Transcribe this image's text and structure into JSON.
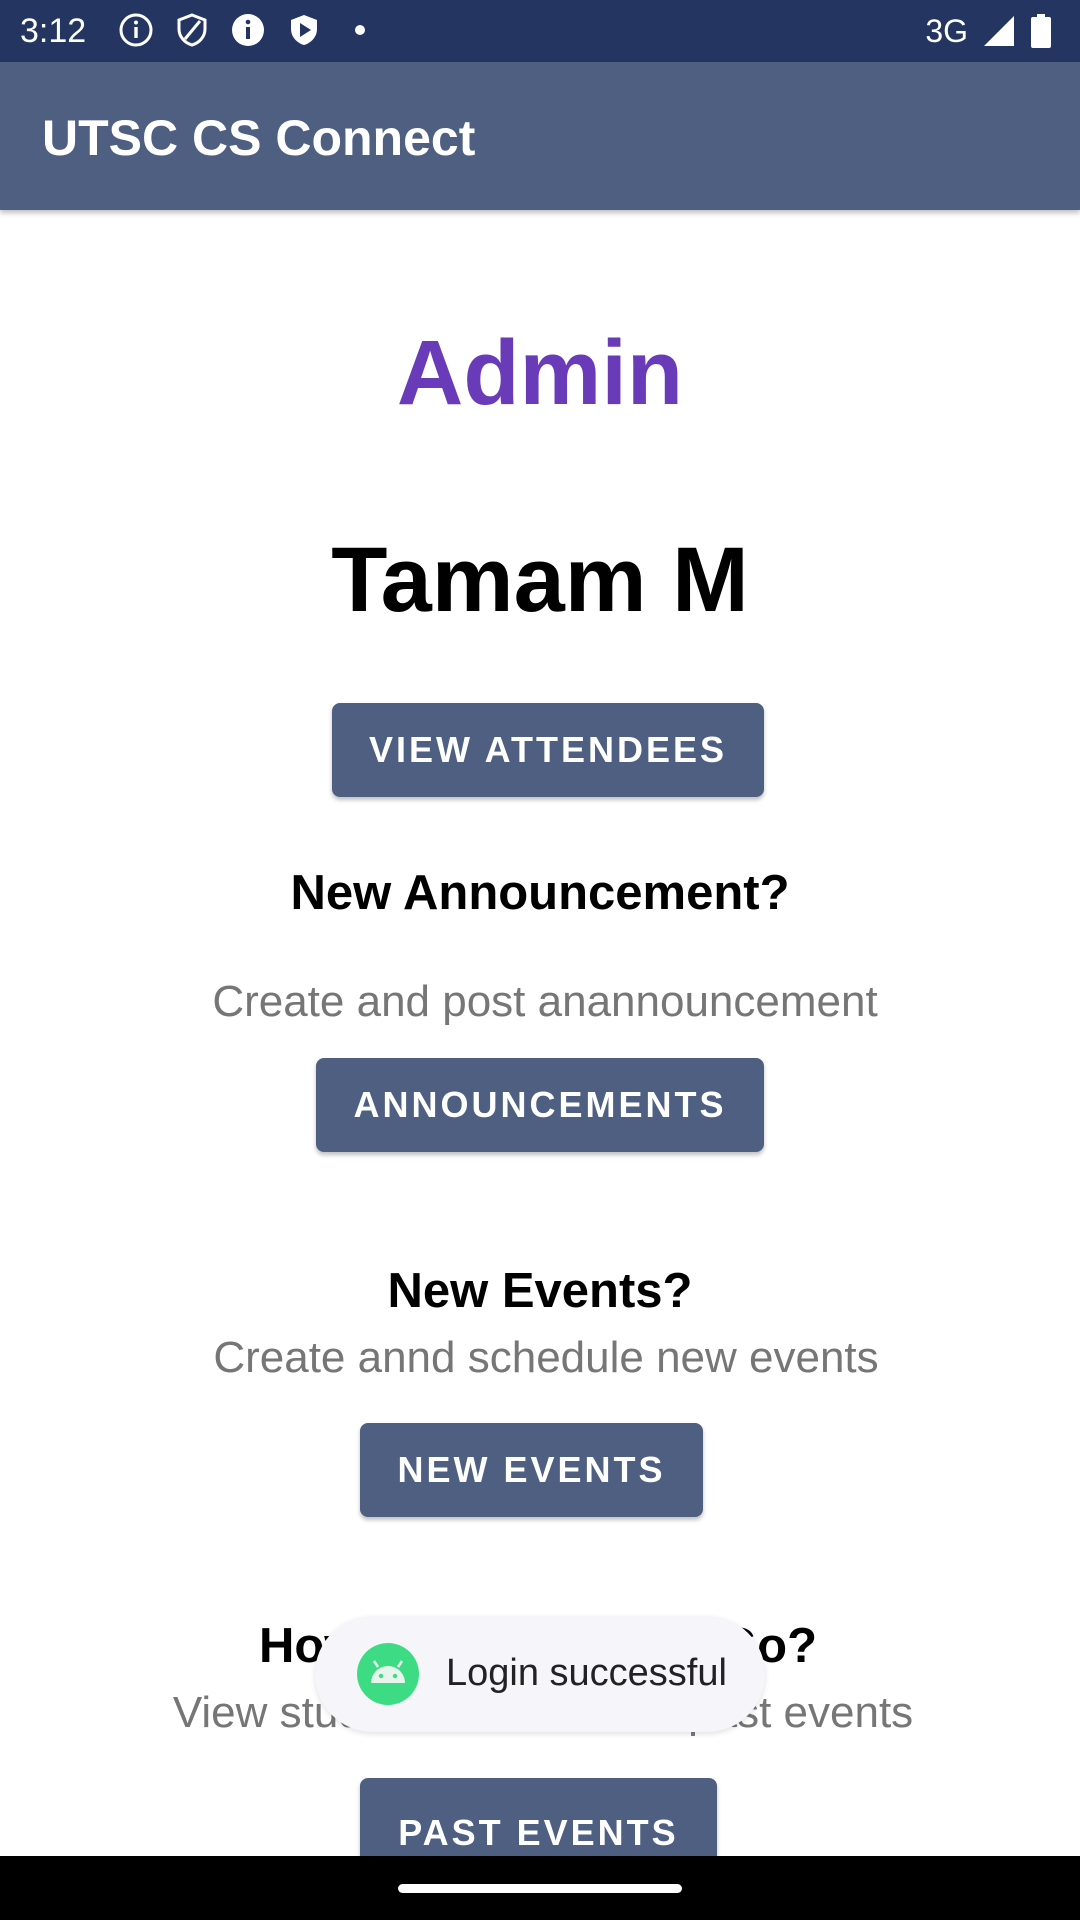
{
  "status_bar": {
    "time": "3:12",
    "network": "3G",
    "icons": [
      "info-icon",
      "shield-icon",
      "info-filled-icon",
      "play-shield-icon",
      "dot-icon",
      "signal-icon",
      "battery-icon"
    ]
  },
  "app_bar": {
    "title": "UTSC CS Connect"
  },
  "main": {
    "role": "Admin",
    "name": "Tamam M",
    "view_attendees_label": "VIEW ATTENDEES",
    "announcement_heading": "New Announcement?",
    "announcement_sub": "Create and post anannouncement",
    "announcements_label": "ANNOUNCEMENTS",
    "events_heading": "New Events?",
    "events_sub": "Create annd schedule new events",
    "new_events_label": "NEW EVENTS",
    "past_heading": "How did the events Go?",
    "past_sub": "View student feedback on past events",
    "past_events_label": "PAST EVENTS"
  },
  "toast": {
    "text": "Login successful",
    "icon": "android-icon"
  },
  "colors": {
    "status_bar": "#233560",
    "app_bar": "#4e5f82",
    "button": "#4e5f82",
    "role_text": "#6a3bb8",
    "subtitle": "#767676"
  }
}
